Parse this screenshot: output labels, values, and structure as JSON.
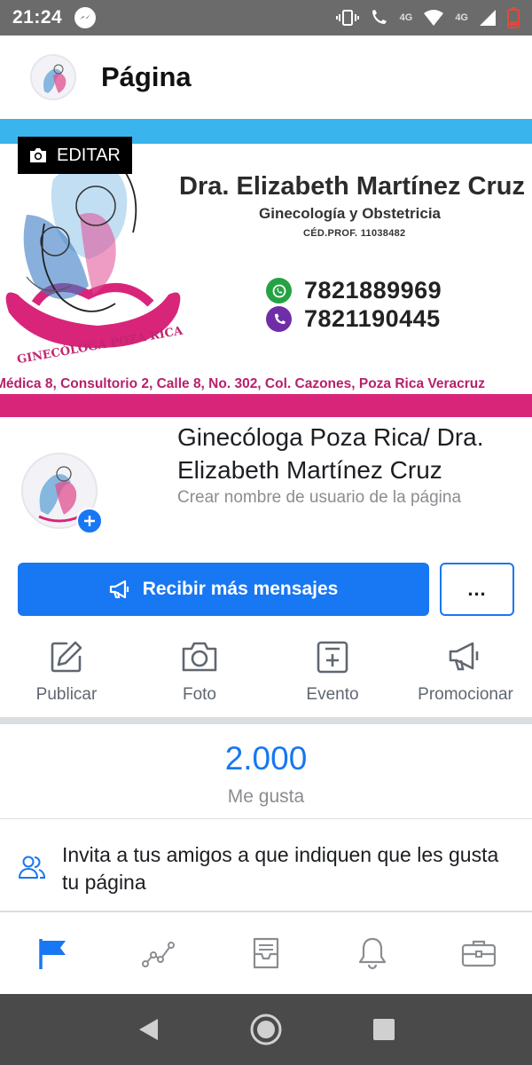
{
  "status_bar": {
    "time": "21:24",
    "network_1": "4G",
    "network_2": "4G"
  },
  "header": {
    "title": "Página"
  },
  "cover": {
    "edit_label": "EDITAR",
    "name": "Dra. Elizabeth Martínez Cruz",
    "specialty": "Ginecología y Obstetricia",
    "cedula": "CÉD.PROF. 11038482",
    "phones": [
      "7821889969",
      "7821190445"
    ],
    "watermark": "GINECÓLOGA POZA RICA",
    "address": "Médica 8, Consultorio 2, Calle 8, No. 302, Col. Cazones, Poza Rica Veracruz"
  },
  "profile": {
    "page_name": "Ginecóloga Poza Rica/ Dra. Elizabeth Martínez Cruz",
    "username_prompt": "Crear nombre de usuario de la página"
  },
  "buttons": {
    "primary_label": "Recibir más mensajes",
    "more_label": "..."
  },
  "actions": [
    {
      "label": "Publicar",
      "icon": "edit-icon"
    },
    {
      "label": "Foto",
      "icon": "camera-icon"
    },
    {
      "label": "Evento",
      "icon": "event-icon"
    },
    {
      "label": "Promocionar",
      "icon": "megaphone-icon"
    }
  ],
  "likes": {
    "count": "2.000",
    "label": "Me gusta"
  },
  "invite": {
    "text": "Invita a tus amigos a que indiquen que les gusta tu página"
  },
  "tabs": [
    {
      "icon": "flag-icon",
      "active": true
    },
    {
      "icon": "insights-icon",
      "active": false
    },
    {
      "icon": "inbox-icon",
      "active": false
    },
    {
      "icon": "bell-icon",
      "active": false
    },
    {
      "icon": "briefcase-icon",
      "active": false
    }
  ],
  "colors": {
    "accent": "#1877f2",
    "cover_pink": "#d8257a",
    "cover_blue": "#3ab4ec",
    "whatsapp": "#25a244",
    "viber": "#6f2da8"
  }
}
